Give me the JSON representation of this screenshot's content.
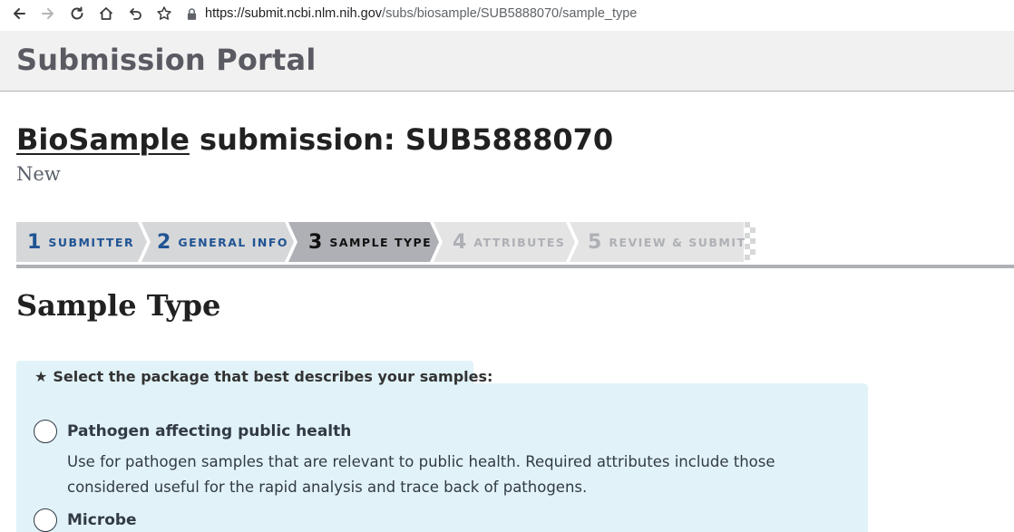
{
  "browser": {
    "url_host": "https://submit.ncbi.nlm.nih.gov",
    "url_path": "/subs/biosample/SUB5888070/sample_type",
    "icons": [
      "back-icon",
      "forward-icon",
      "reload-icon",
      "home-icon",
      "undo-icon",
      "bookmark-star-icon",
      "lock-icon"
    ]
  },
  "header": {
    "title": "Submission Portal"
  },
  "page": {
    "heading_link": "BioSample",
    "heading_rest": " submission: SUB5888070",
    "status": "New"
  },
  "stepper": {
    "steps": [
      {
        "num": "1",
        "label": "SUBMITTER",
        "state": "done"
      },
      {
        "num": "2",
        "label": "GENERAL INFO",
        "state": "done"
      },
      {
        "num": "3",
        "label": "SAMPLE TYPE",
        "state": "current"
      },
      {
        "num": "4",
        "label": "ATTRIBUTES",
        "state": "todo"
      },
      {
        "num": "5",
        "label": "REVIEW & SUBMIT",
        "state": "todo"
      }
    ]
  },
  "section": {
    "title": "Sample Type"
  },
  "package_select": {
    "legend_star": "★",
    "legend": "Select the package that best describes your samples:",
    "options": [
      {
        "title": "Pathogen affecting public health",
        "description": "Use for pathogen samples that are relevant to public health. Required attributes include those considered useful for the rapid analysis and trace back of pathogens."
      },
      {
        "title": "Microbe",
        "description": ""
      }
    ]
  },
  "colors": {
    "step_done": "#205493",
    "step_current_bg": "#aeb0b5",
    "step_bg": "#d6d7d9",
    "panel_bg": "#e1f3f8"
  }
}
